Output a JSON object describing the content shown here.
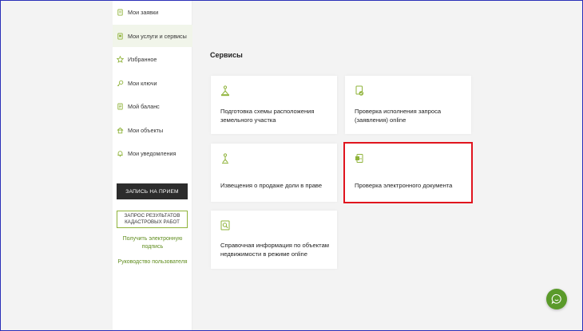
{
  "accent_color": "#8fb33a",
  "selection_color": "#e0141e",
  "sidebar": {
    "items": [
      {
        "label": "Мои заявки",
        "icon": "document-icon"
      },
      {
        "label": "Мои услуги и сервисы",
        "icon": "services-icon",
        "active": true
      },
      {
        "label": "Избранное",
        "icon": "star-icon"
      },
      {
        "label": "Мои ключи",
        "icon": "key-icon"
      },
      {
        "label": "Мой баланс",
        "icon": "balance-icon"
      },
      {
        "label": "Мои объекты",
        "icon": "house-icon"
      },
      {
        "label": "Мои уведомления",
        "icon": "bell-icon"
      }
    ],
    "appointment_button": "ЗАПИСЬ НА ПРИЕМ",
    "cadastral_button": "ЗАПРОС РЕЗУЛЬТАТОВ КАДАСТРОВЫХ РАБОТ",
    "signature_link": "Получить электронную подпись",
    "guide_link": "Руководство пользователя"
  },
  "main": {
    "title": "Сервисы",
    "cards": [
      {
        "text": "Подготовка схемы расположения земельного участка",
        "icon": "surveyor-icon"
      },
      {
        "text": "Проверка исполнения запроса (заявления) online",
        "icon": "check-document-icon"
      },
      {
        "text": "Извещения о продаже доли в праве",
        "icon": "notice-icon"
      },
      {
        "text": "Проверка электронного документа",
        "icon": "electronic-document-icon",
        "selected": true
      },
      {
        "text": "Справочная информация по объектам недвижимости в режиме online",
        "icon": "info-search-icon"
      }
    ]
  },
  "chat": {
    "icon": "chat-icon"
  }
}
